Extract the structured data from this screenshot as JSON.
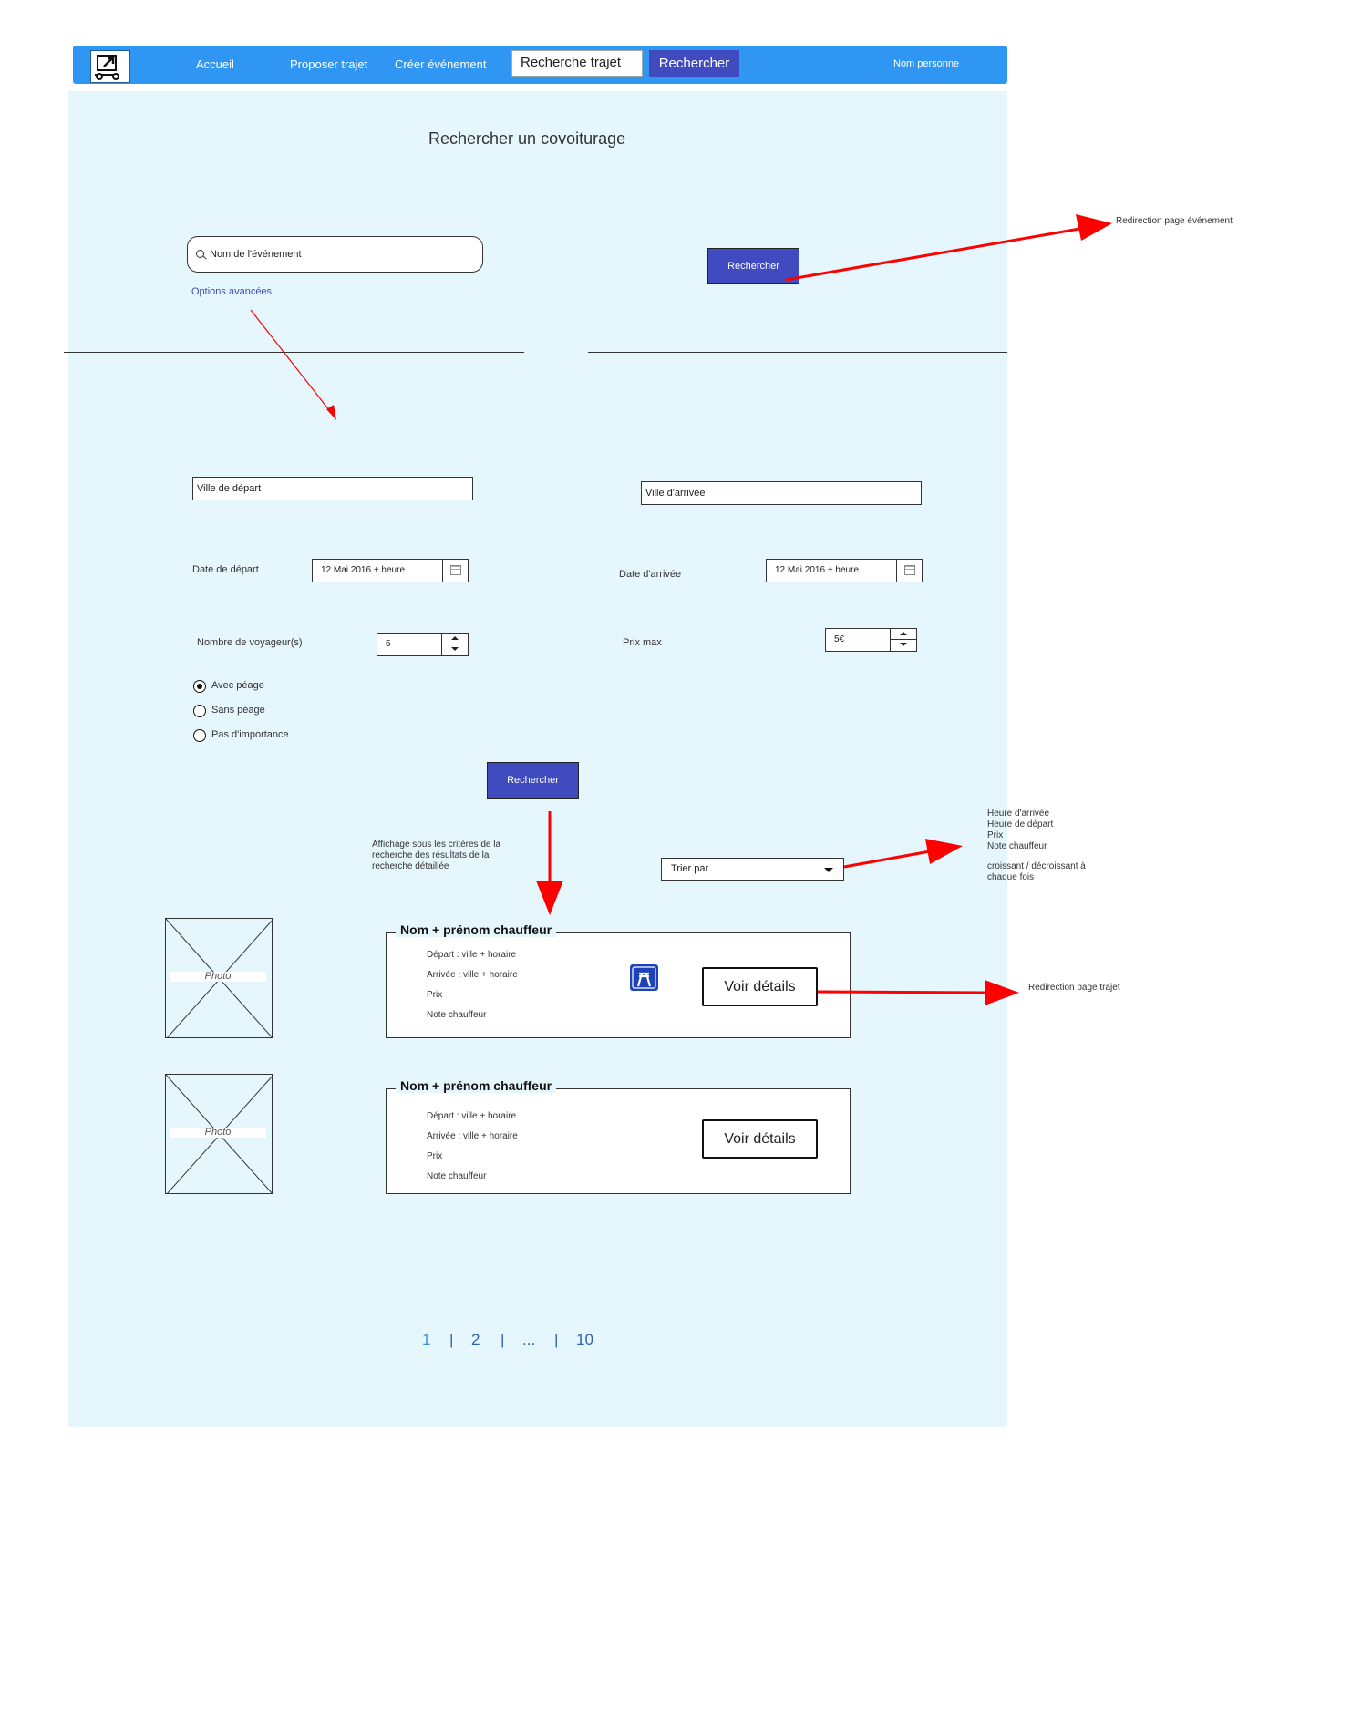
{
  "nav": {
    "links": [
      "Accueil",
      "Proposer trajet",
      "Créer événement"
    ],
    "search_value": "Recherche trajet",
    "search_button": "Rechercher",
    "user": "Nom personne"
  },
  "page_title": "Rechercher un covoiturage",
  "event_search": {
    "placeholder": "Nom de l'événement",
    "button": "Rechercher",
    "advanced_link": "Options avancées"
  },
  "form": {
    "departure_city": "Ville de départ",
    "arrival_city": "Ville d'arrivée",
    "departure_date_label": "Date de départ",
    "departure_date_value": "12 Mai 2016 + heure",
    "arrival_date_label": "Date d'arrivée",
    "arrival_date_value": "12 Mai 2016 + heure",
    "travellers_label": "Nombre de voyageur(s)",
    "travellers_value": "5",
    "max_price_label": "Prix max",
    "max_price_value": "5€",
    "toll_options": [
      "Avec péage",
      "Sans péage",
      "Pas d'importance"
    ],
    "toll_selected": 0,
    "submit": "Rechercher"
  },
  "results_note": "Affichage sous les critères de la recherche des résultats de la recherche détaillée",
  "sort": {
    "label": "Trier par",
    "options_note": [
      "Heure d'arrivée",
      "Heure de départ",
      "Prix",
      "Note chauffeur"
    ],
    "order_note": "croissant / décroissant à chaque fois"
  },
  "annotations": {
    "event_redirect": "Redirection page événement",
    "trip_redirect": "Redirection page trajet"
  },
  "results": [
    {
      "photo": "Photo",
      "driver": "Nom + prénom chauffeur",
      "departure": "Départ : ville + horaire",
      "arrival": "Arrivée : ville + horaire",
      "price": "Prix",
      "rating": "Note chauffeur",
      "details_button": "Voir détails",
      "highway_icon": "highway-sign-icon"
    },
    {
      "photo": "Photo",
      "driver": "Nom + prénom chauffeur",
      "departure": "Départ : ville + horaire",
      "arrival": "Arrivée : ville + horaire",
      "price": "Prix",
      "rating": "Note chauffeur",
      "details_button": "Voir détails"
    }
  ],
  "pagination": {
    "pages": [
      "1",
      "2",
      "...",
      "10"
    ],
    "current": "1",
    "separator": "|"
  },
  "colors": {
    "nav_bg": "#2f96f3",
    "page_bg": "#e6f6fd",
    "button_bg": "#3f4bbf",
    "arrow": "#ff0000"
  }
}
